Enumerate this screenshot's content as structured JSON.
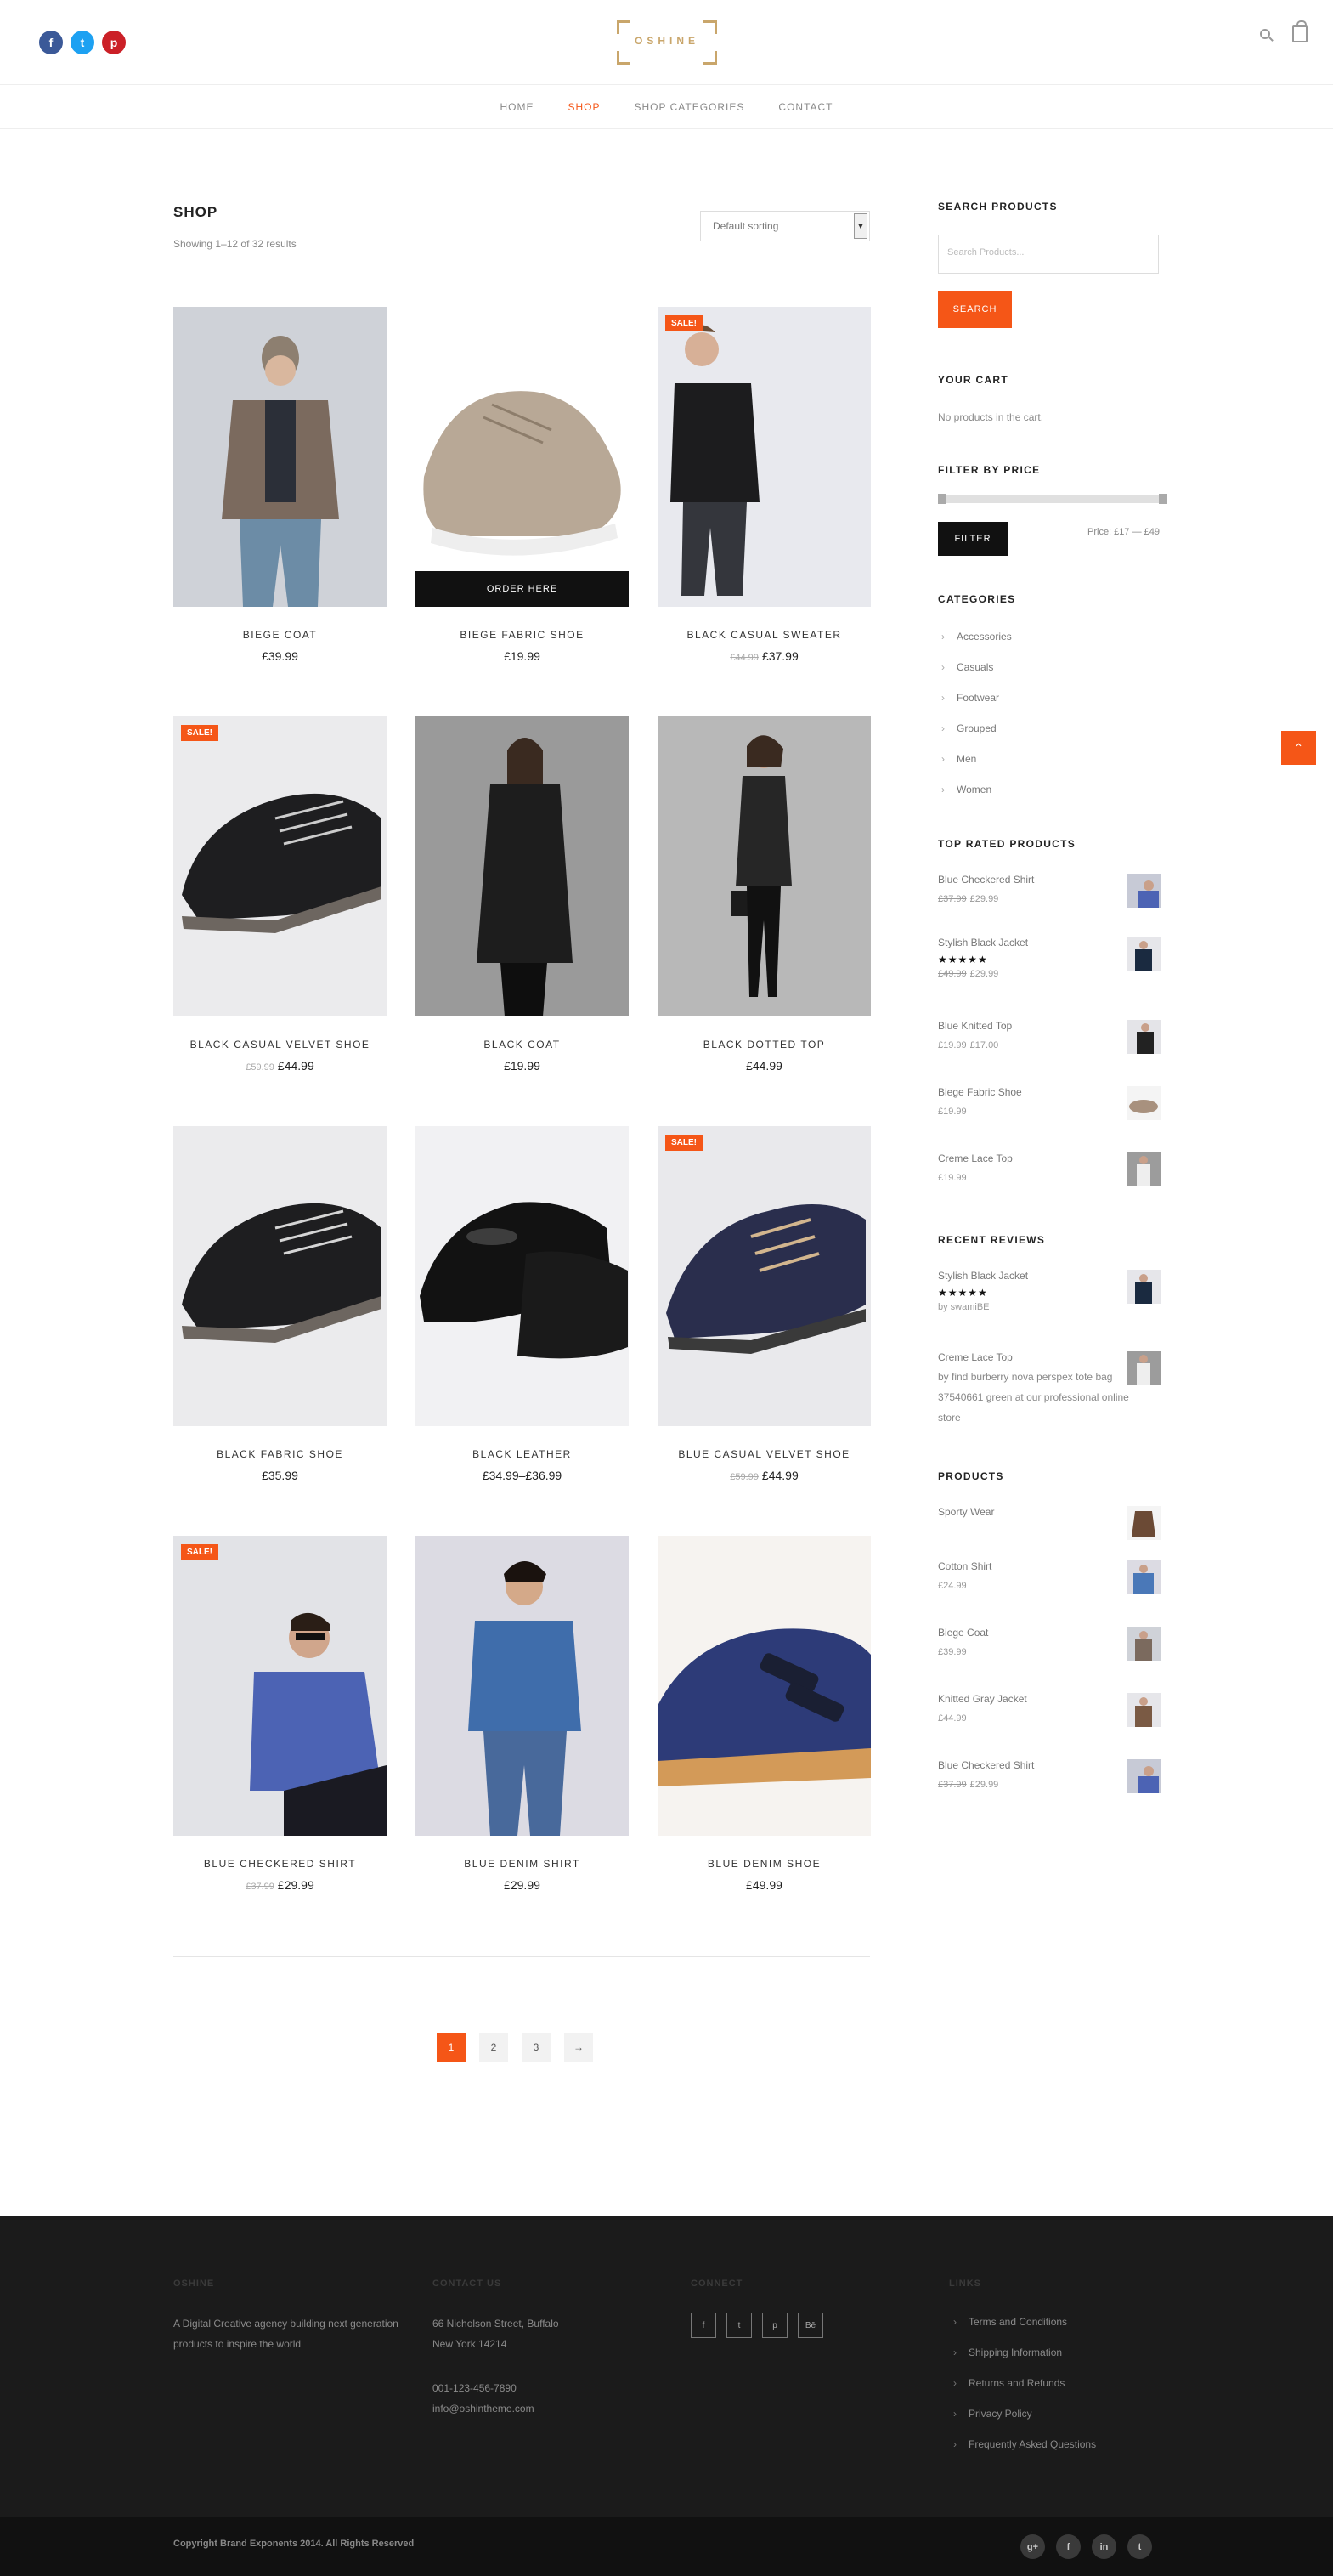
{
  "header": {
    "social": [
      {
        "glyph": "f",
        "color": "#3b5998",
        "icon": "facebook-icon"
      },
      {
        "glyph": "t",
        "color": "#1da1f2",
        "icon": "twitter-icon"
      },
      {
        "glyph": "p",
        "color": "#cb2027",
        "icon": "pinterest-icon"
      }
    ],
    "logo_text": "OSHINE",
    "nav": [
      "HOME",
      "SHOP",
      "SHOP CATEGORIES",
      "CONTACT"
    ],
    "nav_active": "SHOP"
  },
  "shop": {
    "title": "SHOP",
    "result_count": "Showing 1–12 of 32 results",
    "sorting": "Default sorting",
    "order_label": "ORDER HERE",
    "sale_label": "SALE!",
    "products": [
      {
        "name": "BIEGE COAT",
        "price": "£39.99",
        "old_price": "",
        "sale": false
      },
      {
        "name": "BIEGE FABRIC SHOE",
        "price": "£19.99",
        "old_price": "",
        "sale": false
      },
      {
        "name": "BLACK CASUAL SWEATER",
        "price": "£37.99",
        "old_price": "£44.99",
        "sale": true
      },
      {
        "name": "BLACK CASUAL VELVET SHOE",
        "price": "£44.99",
        "old_price": "£59.99",
        "sale": true
      },
      {
        "name": "BLACK COAT",
        "price": "£19.99",
        "old_price": "",
        "sale": false
      },
      {
        "name": "BLACK DOTTED TOP",
        "price": "£44.99",
        "old_price": "",
        "sale": false
      },
      {
        "name": "BLACK FABRIC SHOE",
        "price": "£35.99",
        "old_price": "",
        "sale": false
      },
      {
        "name": "BLACK LEATHER",
        "price": "£34.99–£36.99",
        "old_price": "",
        "sale": false
      },
      {
        "name": "BLUE CASUAL VELVET SHOE",
        "price": "£44.99",
        "old_price": "£59.99",
        "sale": true
      },
      {
        "name": "BLUE CHECKERED SHIRT",
        "price": "£29.99",
        "old_price": "£37.99",
        "sale": true
      },
      {
        "name": "BLUE DENIM SHIRT",
        "price": "£29.99",
        "old_price": "",
        "sale": false
      },
      {
        "name": "BLUE DENIM SHOE",
        "price": "£49.99",
        "old_price": "",
        "sale": false
      }
    ],
    "pagination": [
      "1",
      "2",
      "3",
      "→"
    ]
  },
  "sidebar": {
    "search_title": "SEARCH PRODUCTS",
    "search_placeholder": "Search Products...",
    "search_button": "SEARCH",
    "cart_title": "YOUR CART",
    "cart_empty": "No products in the cart.",
    "filter_title": "FILTER BY PRICE",
    "filter_button": "FILTER",
    "price_range": "Price: £17 — £49",
    "categories_title": "CATEGORIES",
    "categories": [
      "Accessories",
      "Casuals",
      "Footwear",
      "Grouped",
      "Men",
      "Women"
    ],
    "top_rated_title": "TOP RATED PRODUCTS",
    "top_rated": [
      {
        "name": "Blue Checkered Shirt",
        "price": "£29.99",
        "old_price": "£37.99",
        "stars": ""
      },
      {
        "name": "Stylish Black Jacket",
        "price": "£29.99",
        "old_price": "£49.99",
        "stars": "★★★★★"
      },
      {
        "name": "Blue Knitted Top",
        "price": "£17.00",
        "old_price": "£19.99",
        "stars": ""
      },
      {
        "name": "Biege Fabric Shoe",
        "price": "£19.99",
        "old_price": "",
        "stars": ""
      },
      {
        "name": "Creme Lace Top",
        "price": "£19.99",
        "old_price": "",
        "stars": ""
      }
    ],
    "reviews_title": "RECENT REVIEWS",
    "reviews": [
      {
        "product": "Stylish Black Jacket",
        "stars": "★★★★★",
        "by": "by swamiBE"
      },
      {
        "product": "Creme Lace Top",
        "by": "by find burberry nova perspex tote bag 37540661 green at our professional online store"
      }
    ],
    "products_title": "PRODUCTS",
    "products": [
      {
        "name": "Sporty Wear",
        "price": "",
        "old_price": ""
      },
      {
        "name": "Cotton Shirt",
        "price": "£24.99",
        "old_price": ""
      },
      {
        "name": "Biege Coat",
        "price": "£39.99",
        "old_price": ""
      },
      {
        "name": "Knitted Gray Jacket",
        "price": "£44.99",
        "old_price": ""
      },
      {
        "name": "Blue Checkered Shirt",
        "price": "£29.99",
        "old_price": "£37.99"
      }
    ]
  },
  "footer": {
    "col1_title": "OSHINE",
    "col1_text": "A Digital Creative agency building next generation products to inspire the world",
    "col2_title": "CONTACT US",
    "address1": "66 Nicholson Street, Buffalo",
    "address2": "New York 14214",
    "phone": "001-123-456-7890",
    "email": "info@oshintheme.com",
    "col3_title": "CONNECT",
    "connect": [
      "f",
      "t",
      "p",
      "Bē"
    ],
    "col4_title": "LINKS",
    "links": [
      "Terms and Conditions",
      "Shipping Information",
      "Returns and Refunds",
      "Privacy Policy",
      "Frequently Asked Questions"
    ],
    "copyright": "Copyright Brand Exponents 2014. All Rights Reserved",
    "bottom_social": [
      "g+",
      "f",
      "in",
      "t"
    ]
  },
  "colors": {
    "accent": "#f55617",
    "gold": "#c9a66b",
    "footer_bg": "#1b1b1b"
  }
}
